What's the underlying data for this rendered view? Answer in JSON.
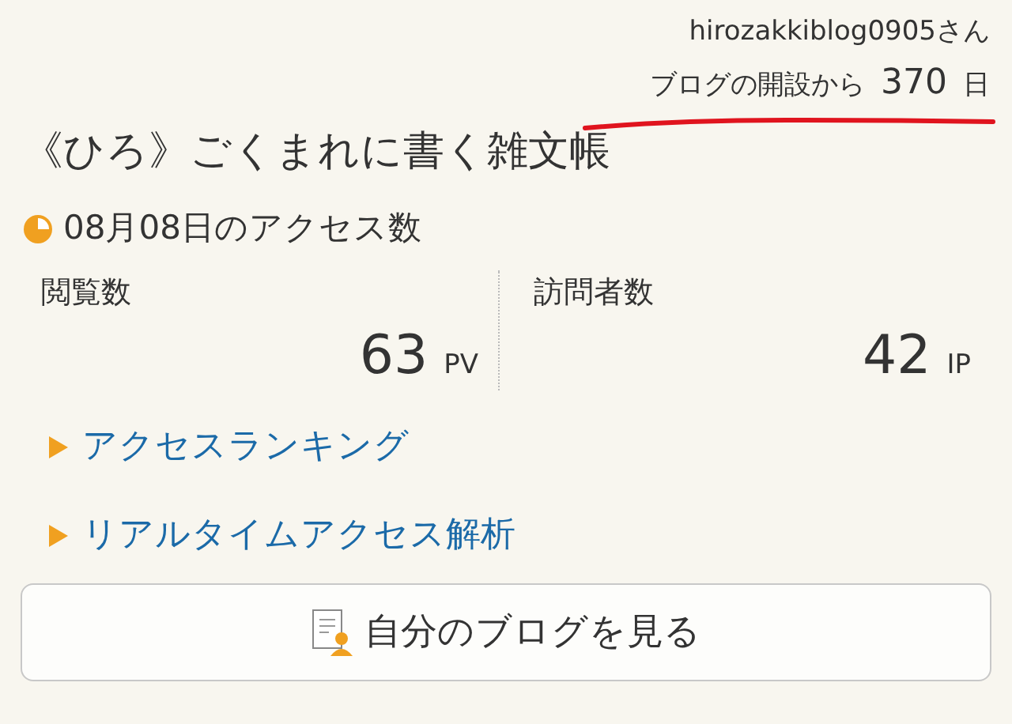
{
  "header": {
    "user": "hirozakkiblog0905さん",
    "since_label": "ブログの開設から",
    "since_days": "370",
    "since_unit": "日"
  },
  "blog_title": "《ひろ》ごくまれに書く雑文帳",
  "access": {
    "title": "08月08日のアクセス数",
    "stats": [
      {
        "label": "閲覧数",
        "value": "63",
        "unit": "PV"
      },
      {
        "label": "訪問者数",
        "value": "42",
        "unit": "IP"
      }
    ]
  },
  "links": [
    "アクセスランキング",
    "リアルタイムアクセス解析"
  ],
  "view_button": "自分のブログを見る"
}
